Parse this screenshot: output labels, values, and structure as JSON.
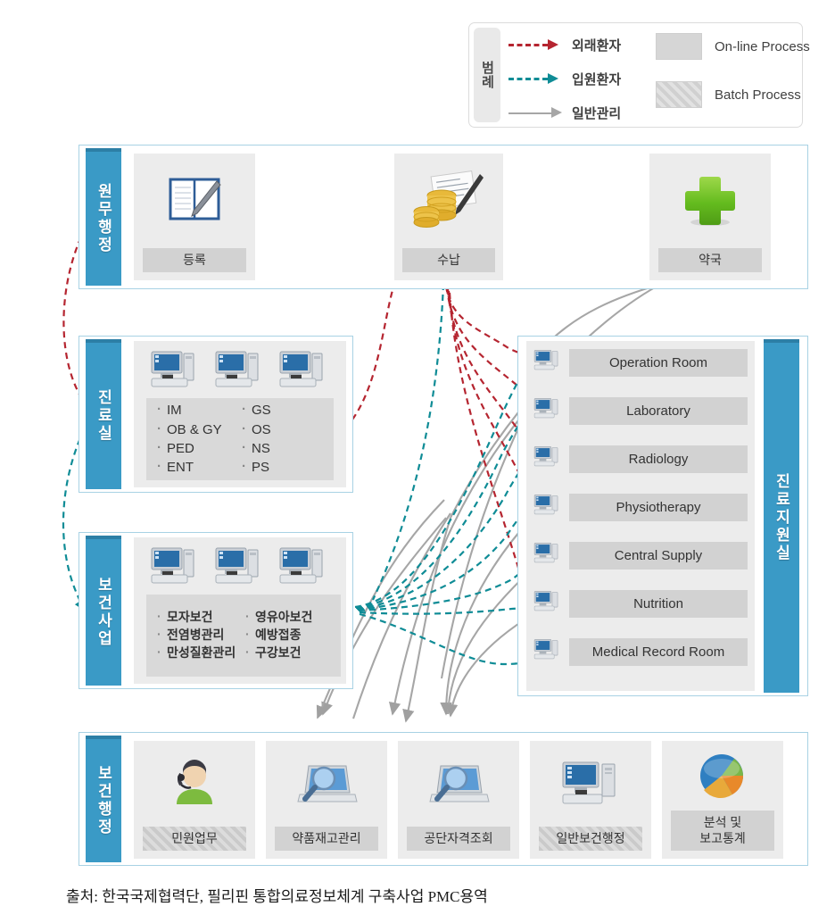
{
  "legend": {
    "title": "범례",
    "flows": [
      {
        "label": "외래환자",
        "style": "dashed",
        "color": "#b52530"
      },
      {
        "label": "입원환자",
        "style": "dashed",
        "color": "#0f8c96"
      },
      {
        "label": "일반관리",
        "style": "solid",
        "color": "#a6a6a6"
      }
    ],
    "process_types": [
      {
        "label": "On-line Process",
        "fill": "solid"
      },
      {
        "label": "Batch Process",
        "fill": "hatched"
      }
    ]
  },
  "sections": {
    "administration": {
      "label": "원무행정",
      "cards": [
        {
          "caption": "등록",
          "icon": "notebook-pen-icon",
          "process": "online"
        },
        {
          "caption": "수납",
          "icon": "coins-invoice-icon",
          "process": "online"
        },
        {
          "caption": "약국",
          "icon": "green-cross-icon",
          "process": "online"
        }
      ]
    },
    "clinic": {
      "label": "진료실",
      "workstations": 3,
      "departments_left": [
        "IM",
        "OB & GY",
        "PED",
        "ENT"
      ],
      "departments_right": [
        "GS",
        "OS",
        "NS",
        "PS"
      ]
    },
    "health_program": {
      "label": "보건사업",
      "workstations": 3,
      "departments_left": [
        "모자보건",
        "전염병관리",
        "만성질환관리"
      ],
      "departments_right": [
        "영유아보건",
        "예방접종",
        "구강보건"
      ]
    },
    "clinical_support": {
      "label": "진료지원실",
      "rooms": [
        "Operation Room",
        "Laboratory",
        "Radiology",
        "Physiotherapy",
        "Central Supply",
        "Nutrition",
        "Medical Record Room"
      ]
    },
    "health_administration": {
      "label": "보건행정",
      "cards": [
        {
          "caption": "민원업무",
          "icon": "headset-agent-icon",
          "process": "batch"
        },
        {
          "caption": "약품재고관리",
          "icon": "laptop-search-icon",
          "process": "online"
        },
        {
          "caption": "공단자격조회",
          "icon": "laptop-search-icon",
          "process": "online"
        },
        {
          "caption": "일반보건행정",
          "icon": "desktop-tower-icon",
          "process": "batch"
        },
        {
          "caption": "분석 및\n보고통계",
          "icon": "pie-chart-icon",
          "process": "online"
        }
      ]
    }
  },
  "caption": "출처: 한국국제협력단, 필리핀 통합의료정보체계 구축사업 PMC용역",
  "colors": {
    "accent_blue": "#3a9ac6",
    "panel_border": "#a8d2e4",
    "outpatient_red": "#b52530",
    "inpatient_teal": "#0f8c96",
    "general_gray": "#a6a6a6",
    "card_bg": "#ececec",
    "caption_bg": "#d2d2d2"
  }
}
